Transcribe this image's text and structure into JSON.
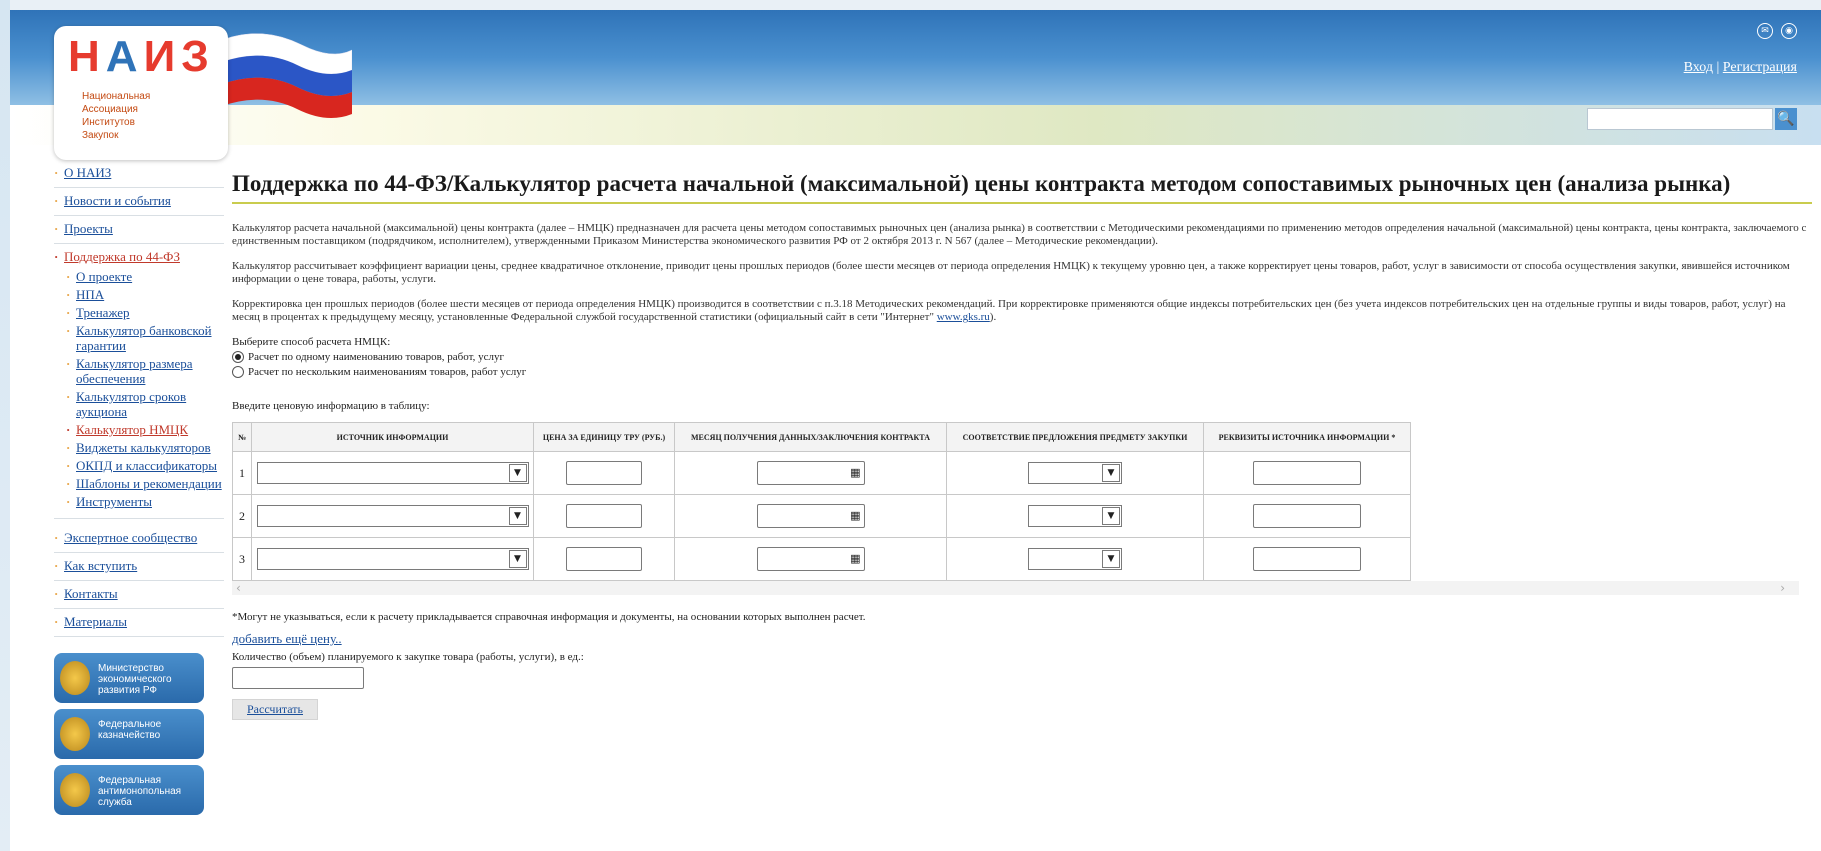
{
  "header": {
    "logo_big": "НАИЗ",
    "logo_sub": [
      "Национальная",
      "Ассоциация",
      "Институтов",
      "Закупок"
    ],
    "icons": [
      "mail-icon",
      "rss-icon"
    ],
    "login": "Вход",
    "separator": "|",
    "register": "Регистрация"
  },
  "sidebar": {
    "items": [
      {
        "label": "О НАИЗ"
      },
      {
        "label": "Новости и события"
      },
      {
        "label": "Проекты"
      },
      {
        "label": "Поддержка по 44-ФЗ"
      }
    ],
    "subitems": [
      {
        "label": "О проекте"
      },
      {
        "label": "НПА"
      },
      {
        "label": "Тренажер"
      },
      {
        "label": "Калькулятор банковской гарантии"
      },
      {
        "label": "Калькулятор размера обеспечения"
      },
      {
        "label": "Калькулятор сроков аукциона"
      },
      {
        "label": "Калькулятор НМЦК"
      },
      {
        "label": "Виджеты калькуляторов"
      },
      {
        "label": "ОКПД и классификаторы"
      },
      {
        "label": "Шаблоны и рекомендации"
      },
      {
        "label": "Инструменты"
      }
    ],
    "items2": [
      {
        "label": "Экспертное сообщество"
      },
      {
        "label": "Как вступить"
      },
      {
        "label": "Контакты"
      },
      {
        "label": "Материалы"
      }
    ],
    "badges": [
      {
        "label": "Министерство экономического развития РФ"
      },
      {
        "label": "Федеральное казначейство"
      },
      {
        "label": "Федеральная антимонопольная служба"
      }
    ]
  },
  "main": {
    "title": "Поддержка по 44-ФЗ/Калькулятор расчета начальной (максимальной) цены контракта методом сопоставимых рыночных цен (анализа рынка)",
    "p1": "Калькулятор расчета начальной (максимальной) цены контракта (далее – НМЦК) предназначен для расчета цены методом сопоставимых рыночных цен (анализа рынка) в соответствии с Методическими рекомендациями по применению методов определения начальной (максимальной) цены контракта, цены контракта, заключаемого с единственным поставщиком (подрядчиком, исполнителем), утвержденными Приказом Министерства экономического развития РФ от 2 октября 2013 г. N 567 (далее – Методические рекомендации).",
    "p2": "Калькулятор рассчитывает коэффициент вариации цены, среднее квадратичное отклонение, приводит цены прошлых периодов (более шести месяцев от периода определения НМЦК) к текущему уровню цен, а также корректирует цены товаров, работ, услуг в зависимости от способа осуществления закупки, явившейся источником информации о цене товара, работы, услуги.",
    "p3": "Корректировка цен прошлых периодов (более шести месяцев от периода определения НМЦК) производится в соответствии с п.3.18 Методических рекомендаций. При корректировке применяются общие индексы потребительских цен (без учета индексов потребительских цен на отдельные группы и виды товаров, работ, услуг) на месяц в процентах к предыдущему месяцу, установленные Федеральной службой государственной статистики (официальный сайт в сети \"Интернет\"",
    "p3_link": "www.gks.ru",
    "p3_end": ").",
    "method_label": "Выберите способ расчета НМЦК:",
    "radio1": "Расчет по одному наименованию товаров, работ, услуг",
    "radio2": "Расчет по нескольким наименованиям товаров, работ услуг",
    "table_hint": "Введите ценовую информацию в таблицу:",
    "columns": [
      "№",
      "ИСТОЧНИК ИНФОРМАЦИИ",
      "ЦЕНА ЗА ЕДИНИЦУ ТРУ (РУБ.)",
      "МЕСЯЦ ПОЛУЧЕНИЯ ДАННЫХ/ЗАКЛЮЧЕНИЯ КОНТРАКТА",
      "СООТВЕТСТВИЕ ПРЕДЛОЖЕНИЯ ПРЕДМЕТУ ЗАКУПКИ",
      "РЕКВИЗИТЫ ИСТОЧНИКА ИНФОРМАЦИИ *"
    ],
    "rows": [
      "1",
      "2",
      "3"
    ],
    "note": "*Могут не указываться, если к расчету прикладывается справочная информация и документы, на основании которых выполнен расчет.",
    "add_link": "добавить ещё цену..",
    "qty_label": "Количество (объем) планируемого к закупке товара (работы, услуги), в ед.:",
    "calc_button": "Рассчитать"
  }
}
